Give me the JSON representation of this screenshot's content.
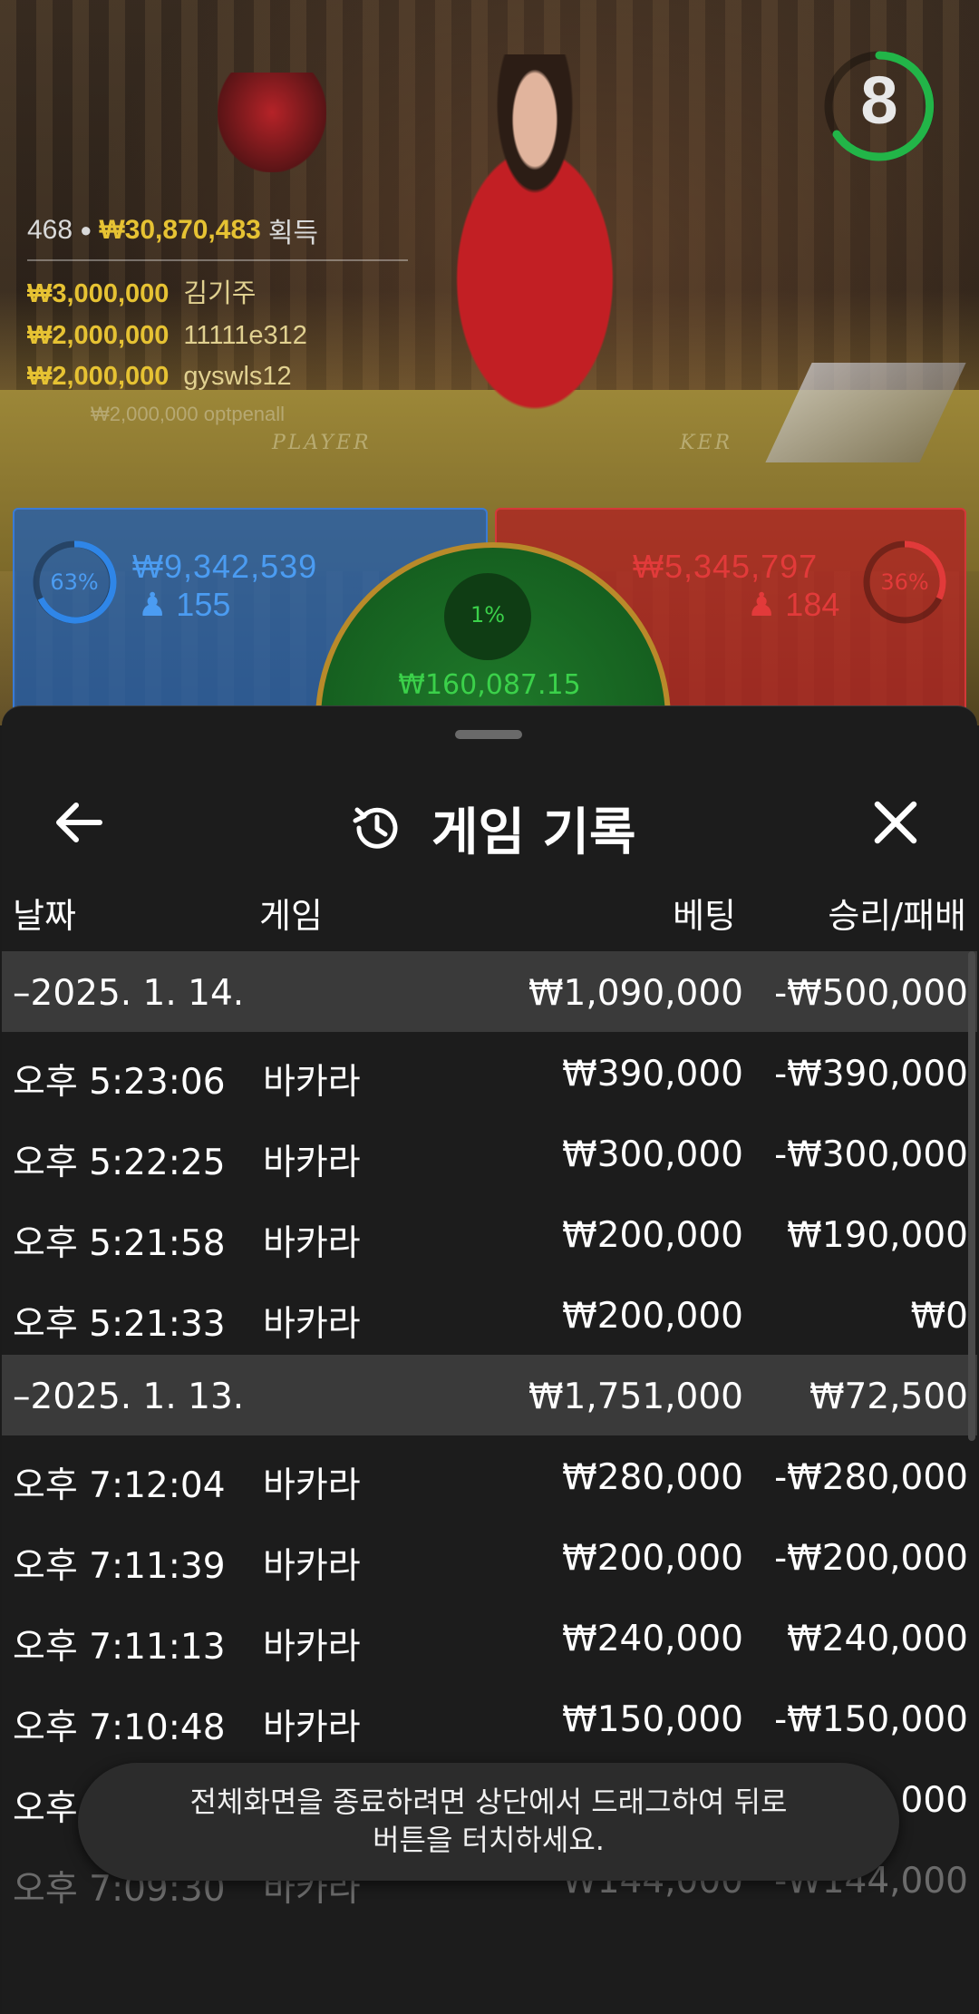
{
  "video": {
    "timer": "8",
    "table_label_player": "PLAYER",
    "table_label_banker": "KER",
    "leaderboard": {
      "player_count": "468",
      "total_amount": "₩30,870,483",
      "total_suffix": "획득",
      "entries": [
        {
          "amount": "₩3,000,000",
          "name": "김기주"
        },
        {
          "amount": "₩2,000,000",
          "name": "11111e312"
        },
        {
          "amount": "₩2,000,000",
          "name": "gyswls12"
        }
      ],
      "faint_entry": "₩2,000,000 optpenall"
    },
    "player_bet": {
      "percent": "63%",
      "amount": "₩9,342,539",
      "count": "155"
    },
    "banker_bet": {
      "percent": "36%",
      "amount": "₩5,345,797",
      "count": "184"
    },
    "tie_bet": {
      "percent": "1%",
      "amount": "₩160,087.15"
    }
  },
  "sheet": {
    "title": "게임 기록",
    "columns": {
      "date": "날짜",
      "game": "게임",
      "bet": "베팅",
      "result": "승리/패배"
    },
    "rows": [
      {
        "type": "group",
        "date": "–2025. 1. 14.",
        "game": "",
        "bet": "₩1,090,000",
        "result": "-₩500,000"
      },
      {
        "type": "item",
        "date": "오후 5:23:06",
        "game": "바카라",
        "bet": "₩390,000",
        "result": "-₩390,000"
      },
      {
        "type": "item",
        "date": "오후 5:22:25",
        "game": "바카라",
        "bet": "₩300,000",
        "result": "-₩300,000"
      },
      {
        "type": "item",
        "date": "오후 5:21:58",
        "game": "바카라",
        "bet": "₩200,000",
        "result": "₩190,000"
      },
      {
        "type": "item",
        "date": "오후 5:21:33",
        "game": "바카라",
        "bet": "₩200,000",
        "result": "₩0"
      },
      {
        "type": "group",
        "date": "–2025. 1. 13.",
        "game": "",
        "bet": "₩1,751,000",
        "result": "₩72,500"
      },
      {
        "type": "item",
        "date": "오후 7:12:04",
        "game": "바카라",
        "bet": "₩280,000",
        "result": "-₩280,000"
      },
      {
        "type": "item",
        "date": "오후 7:11:39",
        "game": "바카라",
        "bet": "₩200,000",
        "result": "-₩200,000"
      },
      {
        "type": "item",
        "date": "오후 7:11:13",
        "game": "바카라",
        "bet": "₩240,000",
        "result": "₩240,000"
      },
      {
        "type": "item",
        "date": "오후 7:10:48",
        "game": "바카라",
        "bet": "₩150,000",
        "result": "-₩150,000"
      },
      {
        "type": "item",
        "date": "오후",
        "game": "",
        "bet": "",
        "result": "000"
      },
      {
        "type": "item",
        "date": "오후 7:09:30",
        "game": "바카라",
        "bet": "₩144,000",
        "result": "-₩144,000",
        "faded": true
      }
    ]
  },
  "toast": {
    "line1": "전체화면을 종료하려면 상단에서 드래그하여 뒤로",
    "line2": "버튼을 터치하세요."
  },
  "colors": {
    "player_blue": "#3a7bd5",
    "banker_red": "#d43838",
    "tie_green": "#3bd14a",
    "gold": "#e6c233",
    "sheet_bg": "#1c1c1c",
    "group_row_bg": "#3a3a3a"
  },
  "icons": {
    "back": "arrow-left-icon",
    "history": "history-icon",
    "close": "close-icon",
    "person": "person-icon"
  }
}
